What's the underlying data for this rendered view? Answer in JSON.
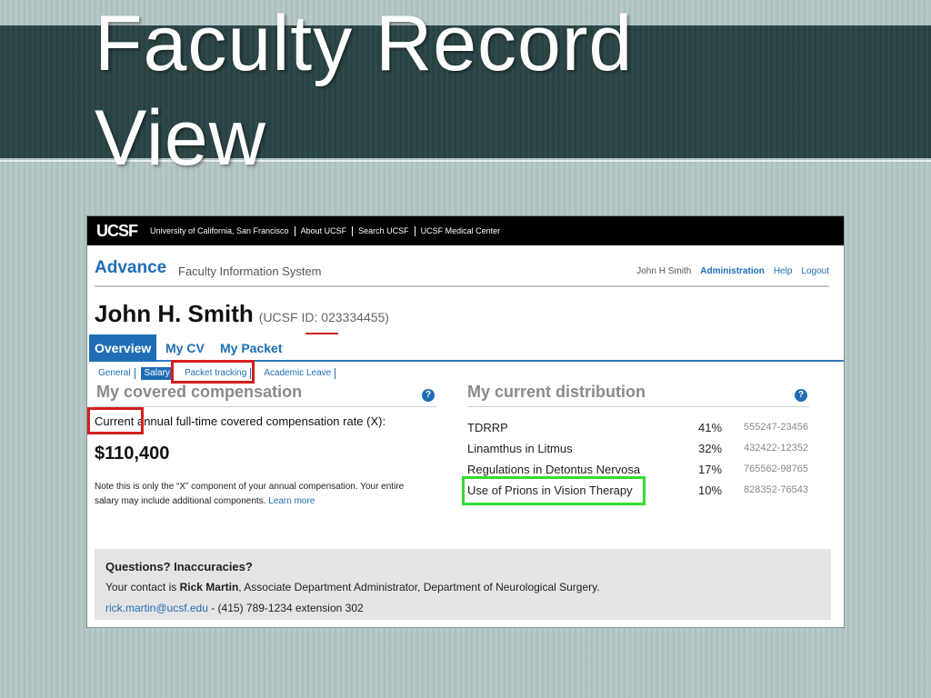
{
  "slide": {
    "title": "Faculty Record\nView"
  },
  "topnav": {
    "logo": "UCSF",
    "links": [
      "University of California, San Francisco",
      "About UCSF",
      "Search UCSF",
      "UCSF Medical Center"
    ]
  },
  "header": {
    "app_name": "Advance",
    "app_subtitle": "Faculty Information System",
    "user_name": "John H Smith",
    "links": [
      "Administration",
      "Help",
      "Logout"
    ]
  },
  "person": {
    "name": "John H. Smith",
    "id": "(UCSF ID: 023334455)"
  },
  "tabs": [
    "Overview",
    "My CV",
    "My Packet"
  ],
  "subtabs": [
    "General",
    "Salary",
    "Packet tracking",
    "Academic Leave"
  ],
  "compensation": {
    "title": "My covered compensation",
    "label": "Current annual full-time covered compensation rate (X):",
    "value": "$110,400",
    "note": "Note this is only the “X” component of your annual compensation. Your entire salary may include additional components.",
    "learn_more": "Learn more"
  },
  "distribution": {
    "title": "My current distribution",
    "rows": [
      {
        "name": "TDRRP",
        "pct": "41%",
        "account": "555247-23456"
      },
      {
        "name": "Linamthus in Litmus",
        "pct": "32%",
        "account": "432422-12352"
      },
      {
        "name": "Regulations in Detontus Nervosa",
        "pct": "17%",
        "account": "765562-98765"
      },
      {
        "name": "Use of Prions in Vision Therapy",
        "pct": "10%",
        "account": "828352-76543"
      }
    ]
  },
  "contact": {
    "heading": "Questions? Inaccuracies?",
    "prefix": "Your contact is ",
    "name": "Rick Martin",
    "role": ", Associate Department Administrator, Department of Neurological Surgery.",
    "email": "rick.martin@ucsf.edu",
    "phone": " - (415) 789-1234 extension 302"
  },
  "help_icon": "?",
  "colors": {
    "accent": "#1f6eb5",
    "highlight_red": "#d42020",
    "highlight_green": "#33dd33"
  }
}
